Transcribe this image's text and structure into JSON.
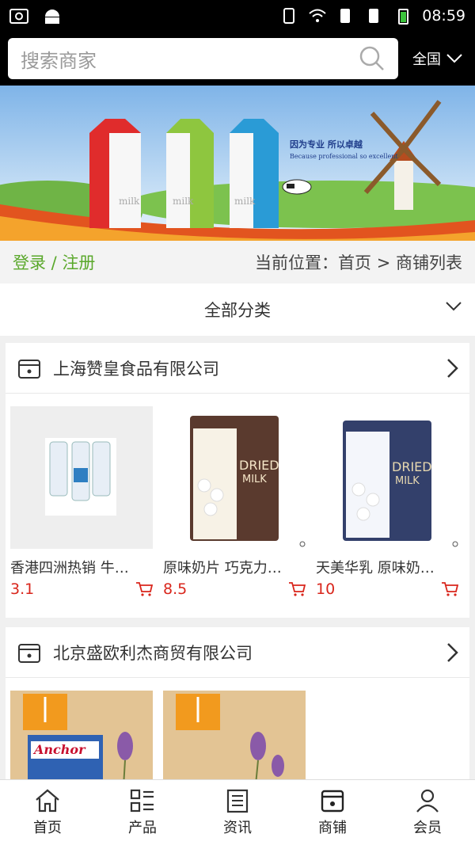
{
  "status_bar": {
    "time": "08:59"
  },
  "search": {
    "placeholder": "搜索商家",
    "region": "全国"
  },
  "login_bar": {
    "login_label": "登录 / 注册",
    "breadcrumb": "当前位置：首页 > 商铺列表"
  },
  "category": {
    "label": "全部分类"
  },
  "banner": {
    "slogan_cn": "因为专业  所以卓越",
    "slogan_en": "Because professional so excellent",
    "carton_text": "milk"
  },
  "shops": [
    {
      "name": "上海赞皇食品有限公司",
      "products": [
        {
          "title": "香港四洲热销 牛…",
          "price": "3.1"
        },
        {
          "title": "原味奶片 巧克力…",
          "price": "8.5"
        },
        {
          "title": "天美华乳 原味奶…",
          "price": "10"
        }
      ]
    },
    {
      "name": "北京盛欧利杰商贸有限公司",
      "products": [
        {
          "title": "",
          "price": "",
          "label": "Anchor"
        },
        {
          "title": "",
          "price": ""
        }
      ]
    }
  ],
  "bottom_nav": [
    {
      "label": "首页",
      "icon": "home-icon"
    },
    {
      "label": "产品",
      "icon": "product-list-icon"
    },
    {
      "label": "资讯",
      "icon": "news-icon"
    },
    {
      "label": "商铺",
      "icon": "shop-icon"
    },
    {
      "label": "会员",
      "icon": "member-icon"
    }
  ],
  "colors": {
    "accent_green": "#5aa82b",
    "price_red": "#d9261c"
  }
}
